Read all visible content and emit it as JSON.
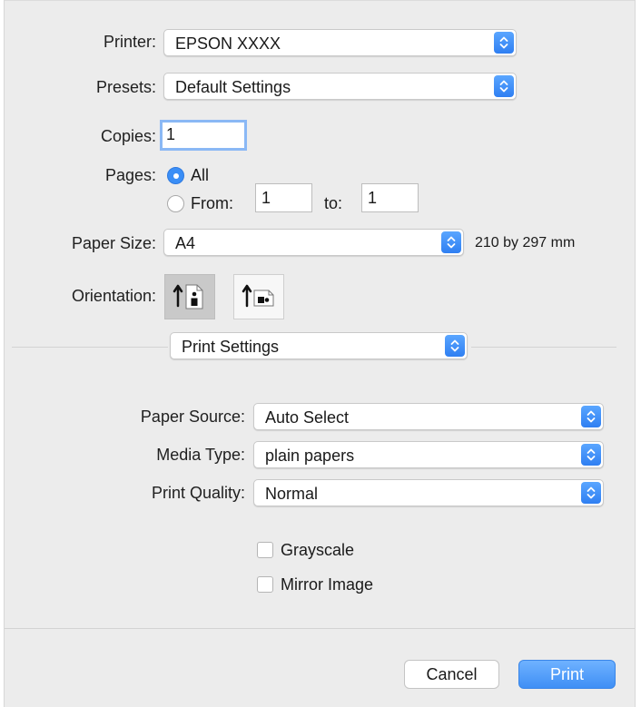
{
  "printer": {
    "label": "Printer:",
    "value": "EPSON XXXX"
  },
  "presets": {
    "label": "Presets:",
    "value": "Default Settings"
  },
  "copies": {
    "label": "Copies:",
    "value": "1"
  },
  "pages": {
    "label": "Pages:",
    "all_label": "All",
    "from_label": "From:",
    "from_value": "1",
    "to_label": "to:",
    "to_value": "1",
    "selected": "All"
  },
  "paper_size": {
    "label": "Paper Size:",
    "value": "A4",
    "dimensions": "210 by 297 mm"
  },
  "orientation": {
    "label": "Orientation:",
    "selected": "portrait"
  },
  "section": {
    "value": "Print Settings"
  },
  "paper_source": {
    "label": "Paper Source:",
    "value": "Auto Select"
  },
  "media_type": {
    "label": "Media Type:",
    "value": "plain papers"
  },
  "print_quality": {
    "label": "Print Quality:",
    "value": "Normal"
  },
  "options": {
    "grayscale_label": "Grayscale",
    "grayscale_checked": false,
    "mirror_label": "Mirror Image",
    "mirror_checked": false
  },
  "buttons": {
    "cancel": "Cancel",
    "print": "Print"
  },
  "colors": {
    "accent": "#3a8ef6",
    "background": "#ececec"
  },
  "icons": {
    "stepper": "updown-chevron-icon",
    "portrait": "portrait-orientation-icon",
    "landscape": "landscape-orientation-icon"
  }
}
